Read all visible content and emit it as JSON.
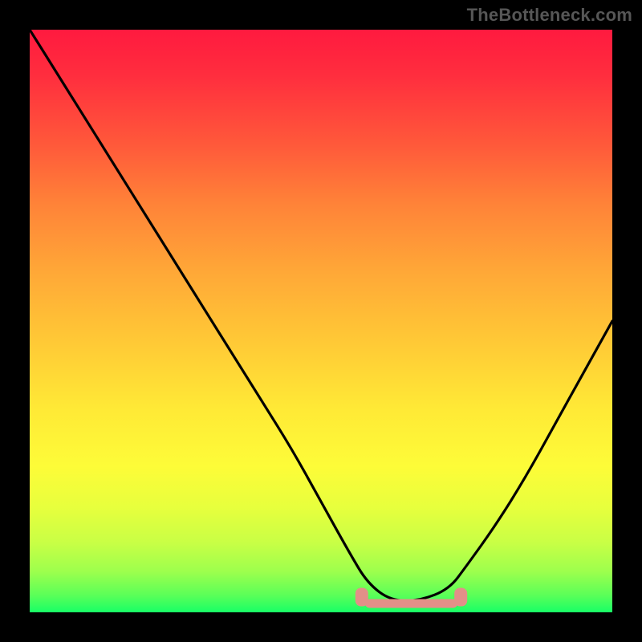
{
  "watermark": "TheBottleneck.com",
  "chart_data": {
    "type": "line",
    "title": "",
    "xlabel": "",
    "ylabel": "",
    "xlim": [
      0,
      100
    ],
    "ylim": [
      0,
      100
    ],
    "grid": false,
    "legend": false,
    "series": [
      {
        "name": "bottleneck-curve",
        "x": [
          0,
          5,
          10,
          15,
          20,
          25,
          30,
          35,
          40,
          45,
          50,
          55,
          58,
          62,
          67,
          72,
          75,
          80,
          85,
          90,
          95,
          100
        ],
        "y": [
          100,
          92,
          84,
          76,
          68,
          60,
          52,
          44,
          36,
          28,
          19,
          10,
          5,
          2,
          2,
          4,
          8,
          15,
          23,
          32,
          41,
          50
        ]
      }
    ],
    "optimal_zone": {
      "x_start": 57,
      "x_end": 74,
      "y_level": 2
    },
    "background_gradient": {
      "top": "#ff1a3f",
      "mid": "#ffe936",
      "bottom": "#18ff66"
    },
    "curve_color": "#000000",
    "zone_color": "#e29088"
  }
}
